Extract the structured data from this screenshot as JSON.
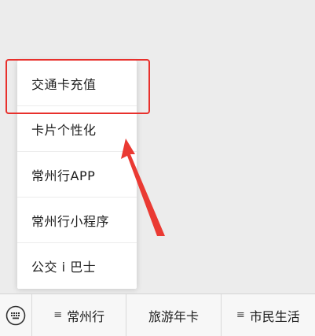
{
  "popup_menu": {
    "items": [
      {
        "label": "交通卡充值"
      },
      {
        "label": "卡片个性化"
      },
      {
        "label": "常州行APP"
      },
      {
        "label": "常州行小程序"
      },
      {
        "label": "公交 i 巴士"
      }
    ]
  },
  "bottom_bar": {
    "keyboard_icon": "keyboard-icon",
    "tabs": [
      {
        "label": "常州行",
        "icon": "menu-icon",
        "icon_glyph": "≡"
      },
      {
        "label": "旅游年卡"
      },
      {
        "label": "市民生活",
        "icon": "menu-icon",
        "icon_glyph": "≡"
      }
    ]
  },
  "annotation": {
    "highlight_color": "#e8302c"
  }
}
